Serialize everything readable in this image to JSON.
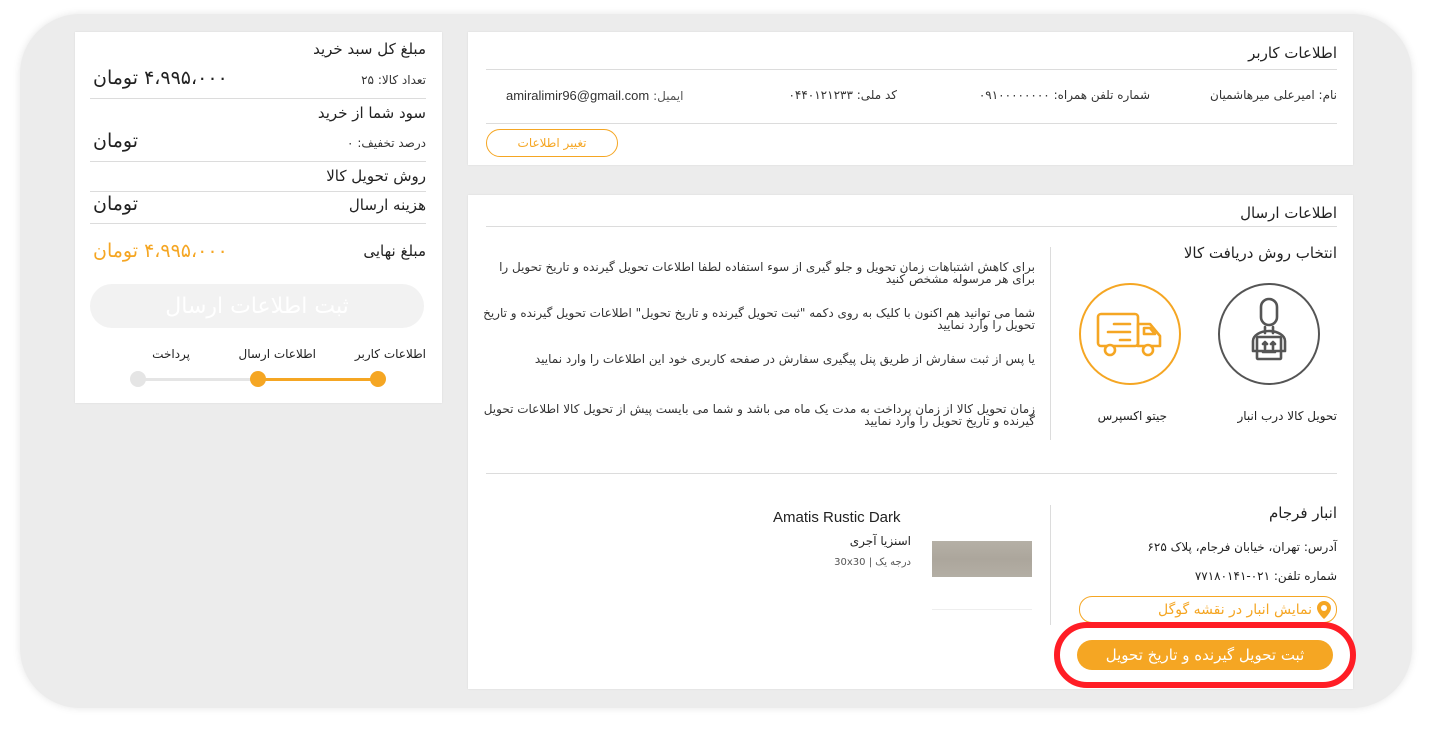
{
  "colors": {
    "accent": "#f5a623",
    "highlight": "#ff1d25",
    "muted": "#e5e5e5"
  },
  "user_info": {
    "title": "اطلاعات کاربر",
    "name": "نام: امیرعلی میرهاشمیان",
    "phone": "شماره تلفن همراه: ۰۹۱۰۰۰۰۰۰۰۰",
    "national_id": "کد ملی: ۰۴۴۰۱۲۱۲۳۳",
    "email_label": "ایمیل:",
    "email": "amiralimir96@gmail.com",
    "edit_button": "تغییر اطلاعات"
  },
  "shipping": {
    "title": "اطلاعات ارسال",
    "choose_method": "انتخاب روش دریافت کالا",
    "options": [
      {
        "label": "تحویل کالا درب انبار",
        "icon": "warehouse-worker-icon"
      },
      {
        "label": "جیتو اکسپرس",
        "icon": "truck-icon"
      }
    ],
    "notes": [
      "برای کاهش اشتباهات زمان تحویل و جلو گیری از سوء استفاده لطفا اطلاعات تحویل گیرنده و تاریخ تحویل را برای هر مرسوله مشخص کنید",
      "شما می توانید هم اکنون با کلیک به روی دکمه \"ثبت تحویل گیرنده و تاریخ تحویل\" اطلاعات تحویل گیرنده و تاریخ تحویل را وارد نمایید",
      "یا پس از ثبت سفارش از طریق پنل پیگیری سفارش در صفحه کاربری خود این اطلاعات را وارد نمایید",
      "زمان تحویل کالا از زمان پرداخت به مدت یک ماه می باشد و شما می بایست پیش از تحویل کالا اطلاعات تحویل گیرنده و تاریخ تحویل را وارد نمایید"
    ],
    "warehouse": {
      "name": "انبار فرجام",
      "address": "آدرس: تهران، خیابان فرجام، پلاک ۶۲۵",
      "phone": "شماره تلفن: ۰۲۱-۷۷۱۸۰۱۴۱",
      "map_button": "نمایش انبار در نقشه گوگل",
      "confirm_button": "ثبت تحویل گیرنده و تاریخ تحویل"
    },
    "product": {
      "name": "Amatis Rustic Dark",
      "type": "اسنزیا آجری",
      "spec": "درجه یک | 30x30"
    }
  },
  "summary": {
    "cart_total_label": "مبلغ کل سبد خرید",
    "item_count": "تعداد کالا: ۲۵",
    "cart_total_value": "۴،۹۹۵،۰۰۰  تومان",
    "profit_label": "سود شما از خرید",
    "discount_percent": "درصد تخفیف: ۰",
    "profit_value": "تومان",
    "delivery_method_label": "روش تحویل کالا",
    "shipping_cost_label": "هزینه ارسال",
    "shipping_cost_value": "تومان",
    "final_label": "مبلغ نهایی",
    "final_value": "۴،۹۹۵،۰۰۰  تومان",
    "submit_button": "ثبت اطلاعات ارسال",
    "steps": [
      "اطلاعات کاربر",
      "اطلاعات ارسال",
      "پرداخت"
    ]
  }
}
